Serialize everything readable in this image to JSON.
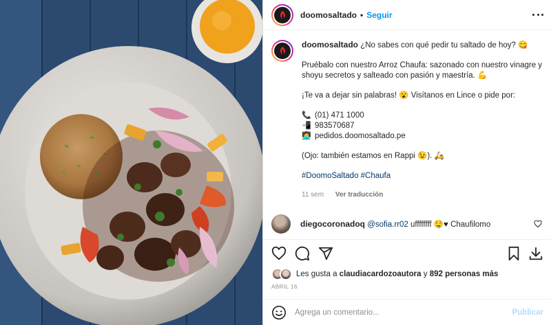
{
  "header": {
    "username": "doomosaltado",
    "separator": "•",
    "follow_label": "Seguir"
  },
  "caption": {
    "username": "doomosaltado",
    "line1": "¿No sabes con qué pedir tu saltado de hoy? 😋",
    "para2": "Pruébalo con nuestro Arroz Chaufa: sazonado con nuestro vinagre y shoyu secretos y salteado con pasión y maestría. 💪",
    "para3": "¡Te va a dejar sin palabras! 😮 Visítanos en Lince o pide por:",
    "phone": "(01) 471 1000",
    "mobile": "983570687",
    "web": "pedidos.doomosaltado.pe",
    "rappi": "(Ojo: también estamos en Rappi 😉). 🛵",
    "hashtags": "#DoomoSaltado #Chaufa",
    "time_ago": "11 sem",
    "see_translation": "Ver traducción"
  },
  "comment": {
    "username": "diegocoronadoq",
    "mention": "@sofia.rr02",
    "text": "uffffffff 🤤♥ Chaufilomo"
  },
  "likes": {
    "prefix": "Les gusta a",
    "user": "claudiacardozoautora",
    "middle": "y",
    "others": "892 personas más"
  },
  "date": "ABRIL 16",
  "add_comment": {
    "placeholder": "Agrega un comentario...",
    "publish_label": "Publicar"
  },
  "icons": [
    "profile-logo-icon",
    "more-options-icon",
    "phone-icon",
    "mobile-icon",
    "web-icon",
    "heart-icon",
    "comment-icon",
    "share-icon",
    "save-icon",
    "download-icon",
    "emoji-icon"
  ],
  "colors": {
    "link_blue": "#0095f6",
    "hashtag_blue": "#00376b",
    "muted": "#8e8e8e",
    "publish_disabled": "#b3dbff"
  }
}
